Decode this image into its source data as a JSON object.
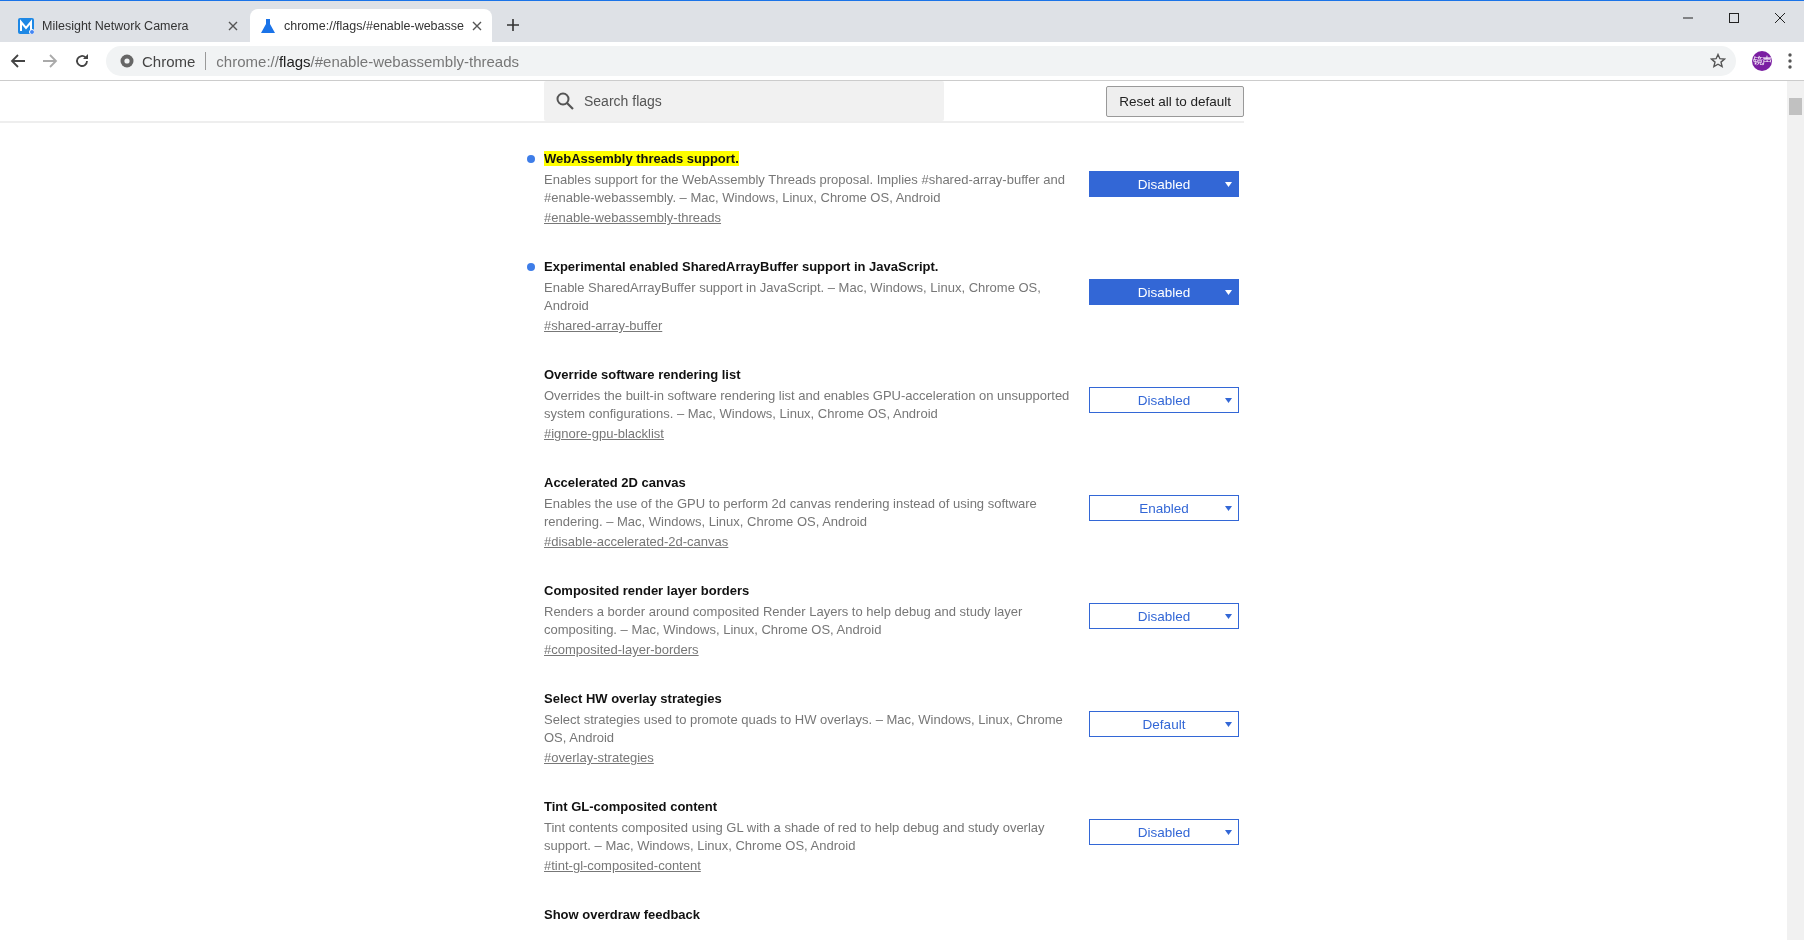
{
  "tabs": [
    {
      "title": "Milesight Network Camera",
      "selected": false
    },
    {
      "title": "chrome://flags/#enable-webasse",
      "selected": true
    }
  ],
  "toolbar": {
    "site_label": "Chrome",
    "url_prefix": "chrome://",
    "url_host": "flags",
    "url_path": "/#enable-webassembly-threads",
    "avatar": "镜声"
  },
  "search": {
    "placeholder": "Search flags"
  },
  "reset_button": "Reset all to default",
  "flags": [
    {
      "title": "WebAssembly threads support.",
      "modified": true,
      "highlighted": true,
      "description": "Enables support for the WebAssembly Threads proposal. Implies #shared-array-buffer and #enable-webassembly. – Mac, Windows, Linux, Chrome OS, Android",
      "anchor": "#enable-webassembly-threads",
      "value": "Disabled"
    },
    {
      "title": "Experimental enabled SharedArrayBuffer support in JavaScript.",
      "modified": true,
      "highlighted": false,
      "description": "Enable SharedArrayBuffer support in JavaScript. – Mac, Windows, Linux, Chrome OS, Android",
      "anchor": "#shared-array-buffer",
      "value": "Disabled"
    },
    {
      "title": "Override software rendering list",
      "modified": false,
      "highlighted": false,
      "description": "Overrides the built-in software rendering list and enables GPU-acceleration on unsupported system configurations. – Mac, Windows, Linux, Chrome OS, Android",
      "anchor": "#ignore-gpu-blacklist",
      "value": "Disabled"
    },
    {
      "title": "Accelerated 2D canvas",
      "modified": false,
      "highlighted": false,
      "description": "Enables the use of the GPU to perform 2d canvas rendering instead of using software rendering. – Mac, Windows, Linux, Chrome OS, Android",
      "anchor": "#disable-accelerated-2d-canvas",
      "value": "Enabled"
    },
    {
      "title": "Composited render layer borders",
      "modified": false,
      "highlighted": false,
      "description": "Renders a border around composited Render Layers to help debug and study layer compositing. – Mac, Windows, Linux, Chrome OS, Android",
      "anchor": "#composited-layer-borders",
      "value": "Disabled"
    },
    {
      "title": "Select HW overlay strategies",
      "modified": false,
      "highlighted": false,
      "description": "Select strategies used to promote quads to HW overlays. – Mac, Windows, Linux, Chrome OS, Android",
      "anchor": "#overlay-strategies",
      "value": "Default"
    },
    {
      "title": "Tint GL-composited content",
      "modified": false,
      "highlighted": false,
      "description": "Tint contents composited using GL with a shade of red to help debug and study overlay support. – Mac, Windows, Linux, Chrome OS, Android",
      "anchor": "#tint-gl-composited-content",
      "value": "Disabled"
    },
    {
      "title": "Show overdraw feedback",
      "modified": false,
      "highlighted": false
    }
  ]
}
